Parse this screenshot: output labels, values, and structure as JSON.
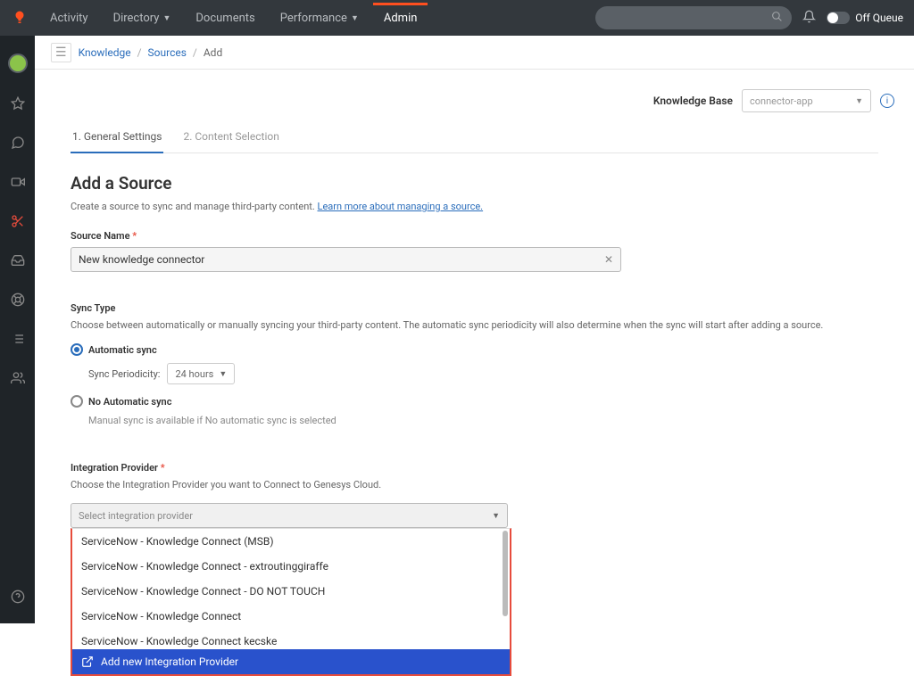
{
  "header": {
    "nav": [
      {
        "label": "Activity",
        "dropdown": false
      },
      {
        "label": "Directory",
        "dropdown": true
      },
      {
        "label": "Documents",
        "dropdown": false
      },
      {
        "label": "Performance",
        "dropdown": true
      },
      {
        "label": "Admin",
        "dropdown": false,
        "active": true
      }
    ],
    "queue_label": "Off Queue"
  },
  "breadcrumb": {
    "items": [
      "Knowledge",
      "Sources"
    ],
    "current": "Add"
  },
  "kb": {
    "label": "Knowledge Base",
    "value": "connector-app"
  },
  "tabs": [
    {
      "label": "1. General Settings",
      "active": true
    },
    {
      "label": "2. Content Selection",
      "active": false
    }
  ],
  "heading": "Add a Source",
  "sub_text": "Create a source to sync and manage third-party content. ",
  "sub_link": "Learn more about managing a source.",
  "source_name": {
    "label": "Source Name",
    "value": "New knowledge connector"
  },
  "sync": {
    "title": "Sync Type",
    "desc": "Choose between automatically or manually syncing your third-party content. The automatic sync periodicity will also determine when the sync will start after adding a source.",
    "auto_label": "Automatic sync",
    "periodicity_label": "Sync Periodicity:",
    "periodicity_value": "24 hours",
    "no_auto_label": "No Automatic sync",
    "no_auto_hint": "Manual sync is available if No automatic sync is selected"
  },
  "integration": {
    "label": "Integration Provider",
    "desc": "Choose the Integration Provider you want to Connect to Genesys Cloud.",
    "placeholder": "Select integration provider",
    "options": [
      "ServiceNow - Knowledge Connect (MSB)",
      "ServiceNow - Knowledge Connect - extroutinggiraffe",
      "ServiceNow - Knowledge Connect - DO NOT TOUCH",
      "ServiceNow - Knowledge Connect",
      "ServiceNow - Knowledge Connect kecske"
    ],
    "action": "Add new Integration Provider"
  }
}
